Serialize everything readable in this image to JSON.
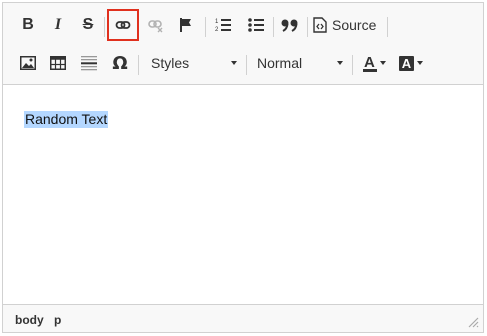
{
  "toolbar": {
    "row1": {
      "bold_glyph": "B",
      "italic_glyph": "I",
      "strike_glyph": "S",
      "source_label": "Source",
      "link_highlight_color": "#e0301e"
    },
    "row2": {
      "omega_glyph": "Ω",
      "styles_label": "Styles",
      "format_label": "Normal",
      "text_color_glyph": "A",
      "bg_color_glyph": "A"
    }
  },
  "content": {
    "selected_text": "Random Text",
    "selection_color": "#b4d7ff"
  },
  "statusbar": {
    "path_items": [
      "body",
      "p"
    ]
  }
}
